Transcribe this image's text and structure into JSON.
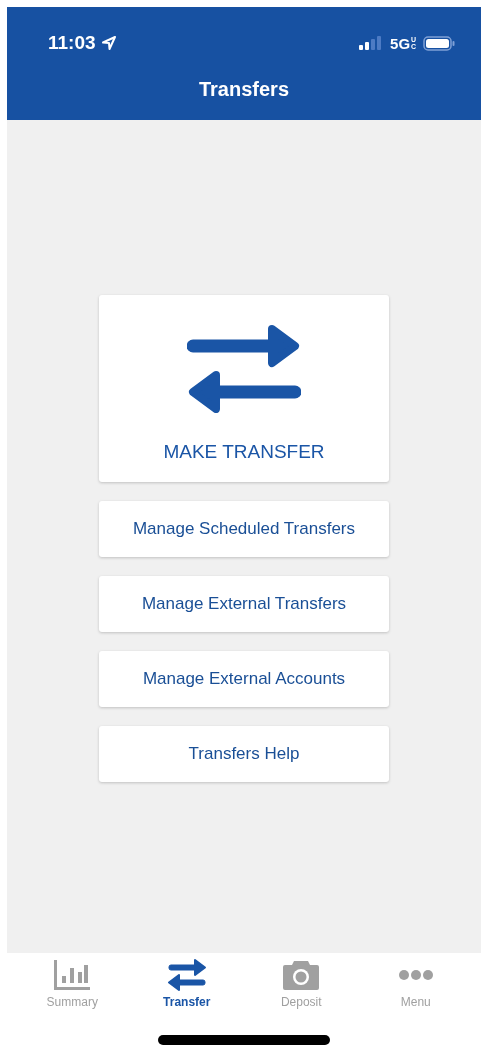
{
  "status_bar": {
    "time": "11:03",
    "network": "5G",
    "network_badge": "UC"
  },
  "header": {
    "title": "Transfers"
  },
  "main_action": {
    "label": "MAKE TRANSFER"
  },
  "links": [
    {
      "label": "Manage Scheduled Transfers"
    },
    {
      "label": "Manage External Transfers"
    },
    {
      "label": "Manage External Accounts"
    },
    {
      "label": "Transfers Help"
    }
  ],
  "tab_bar": [
    {
      "kind": "summary",
      "label": "Summary",
      "selected": false
    },
    {
      "kind": "transfer",
      "label": "Transfer",
      "selected": true
    },
    {
      "kind": "deposit",
      "label": "Deposit",
      "selected": false
    },
    {
      "kind": "menu",
      "label": "Menu",
      "selected": false
    }
  ]
}
